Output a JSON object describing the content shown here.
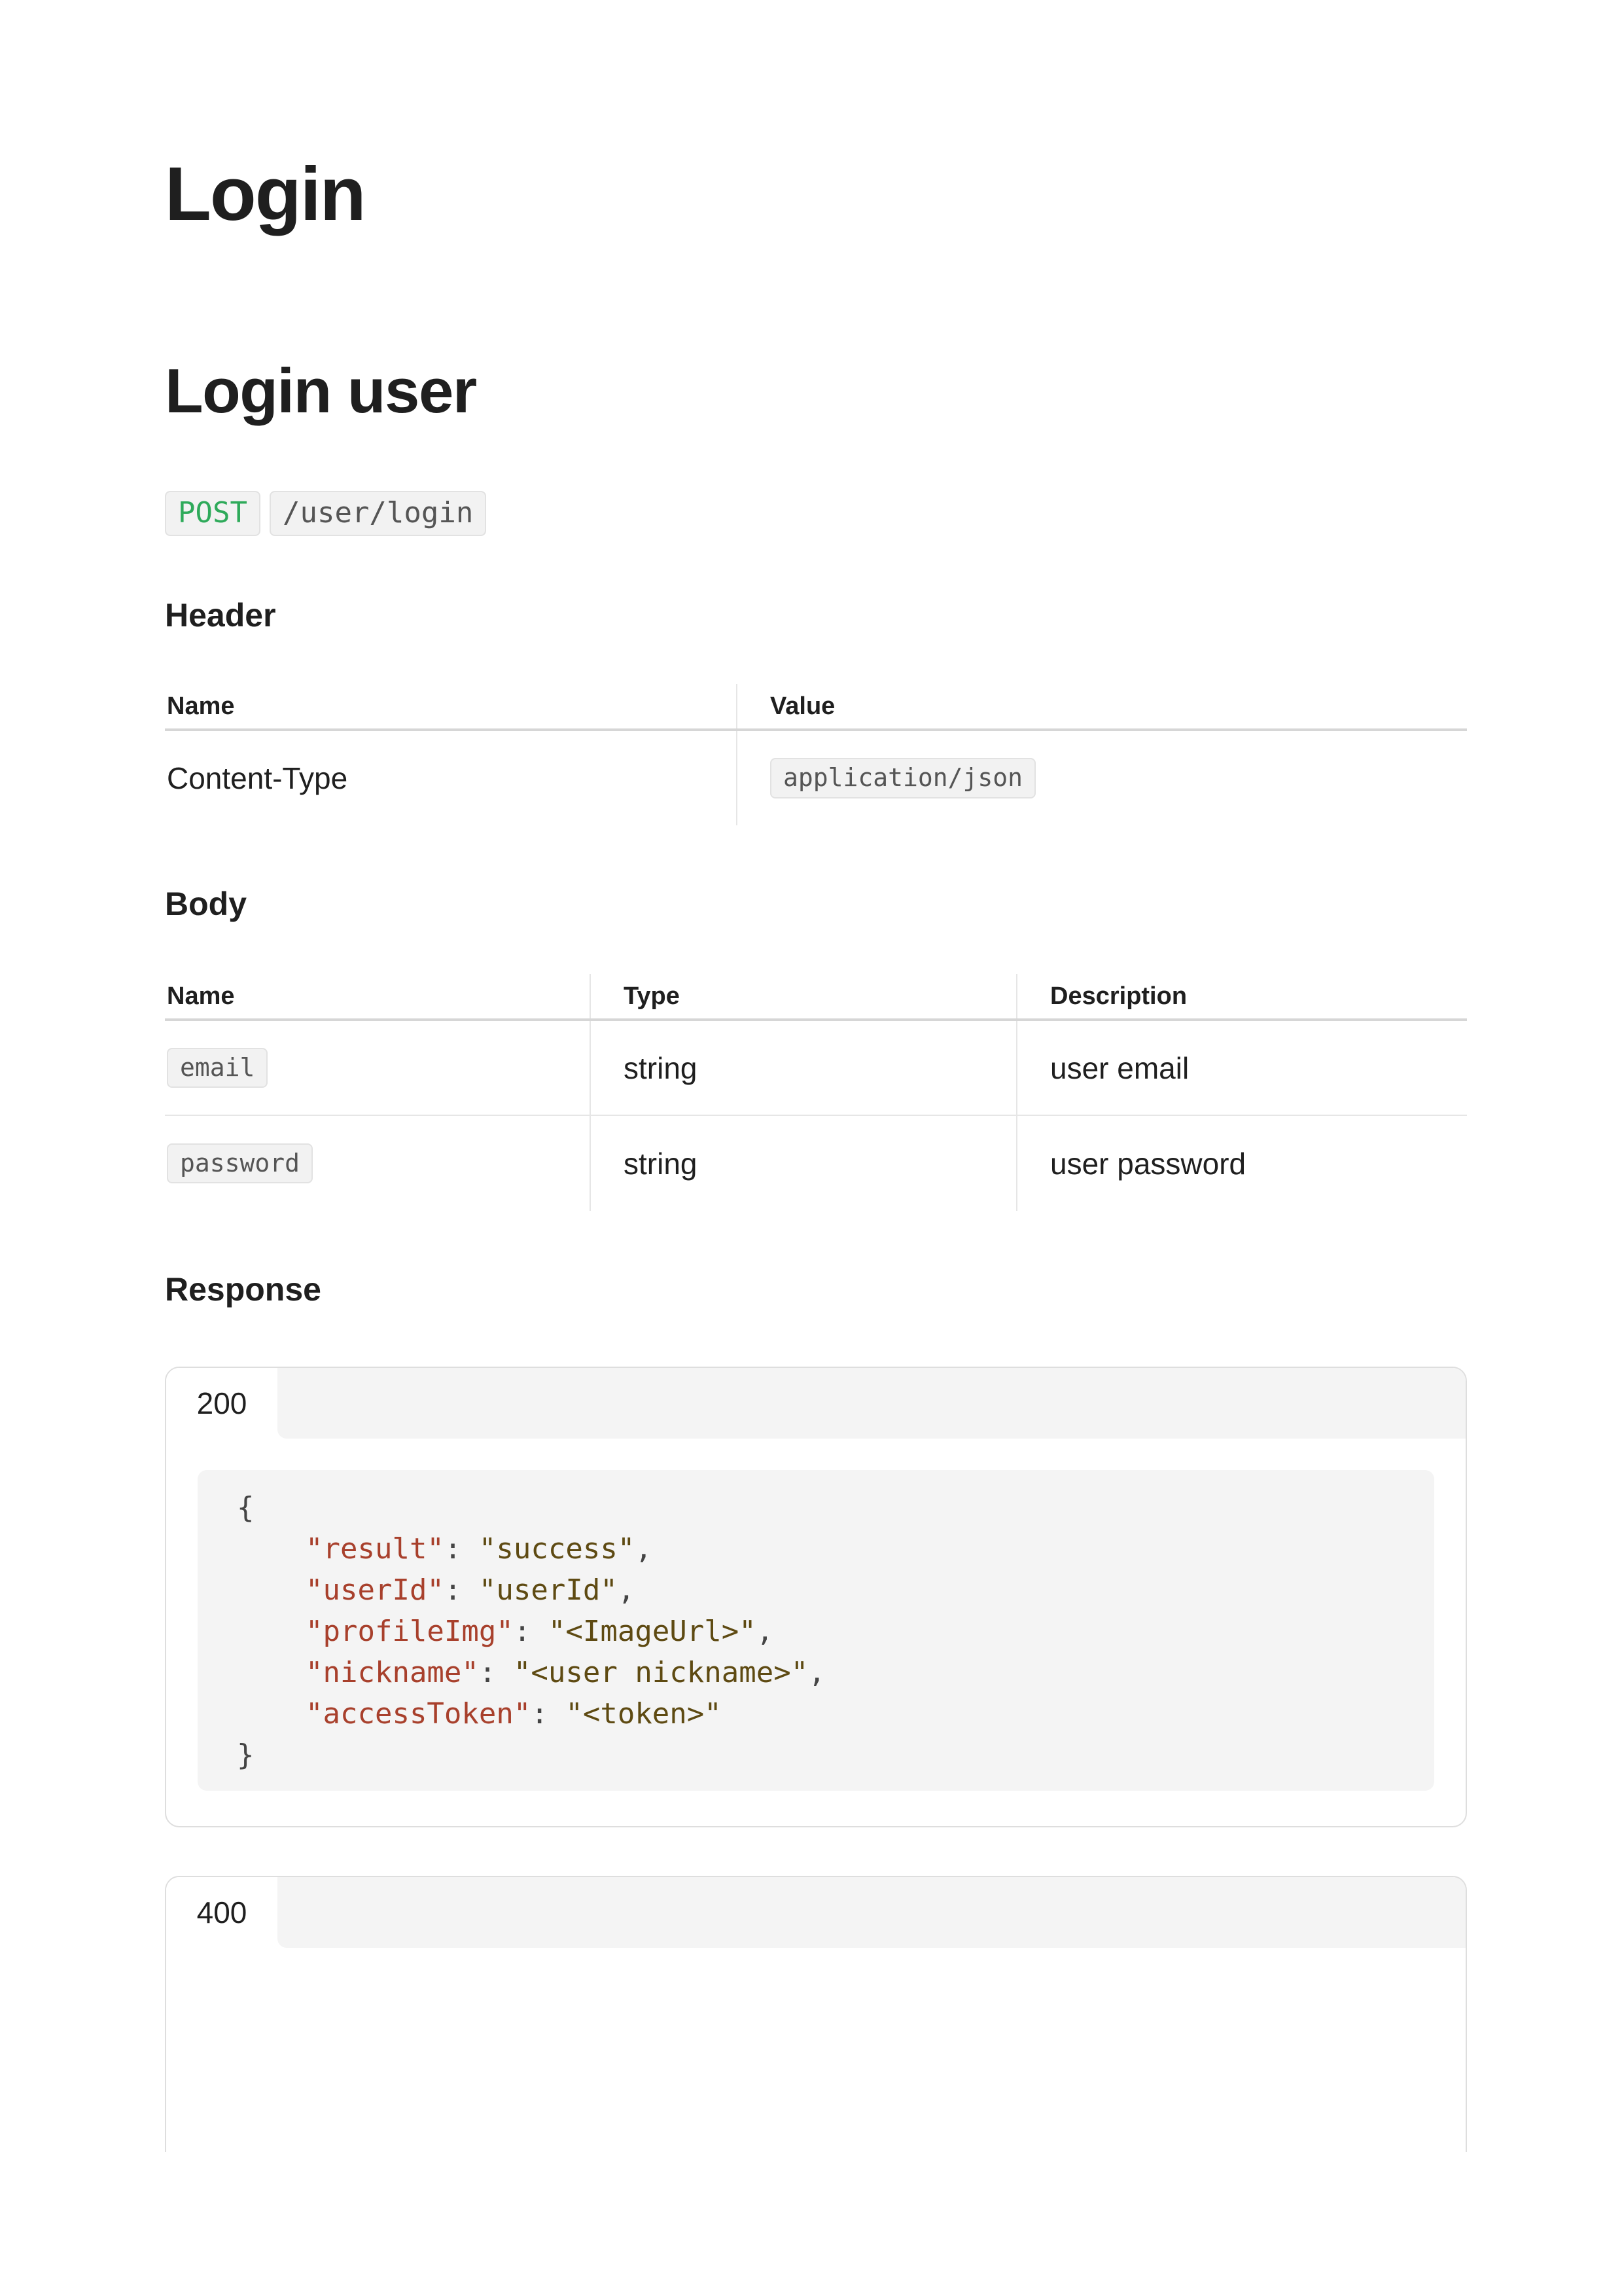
{
  "doc_title": "Login",
  "section_title": "Login user",
  "endpoint": {
    "method": "POST",
    "path": "/user/login"
  },
  "header_section": {
    "title": "Header",
    "columns": [
      "Name",
      "Value"
    ],
    "rows": [
      {
        "name": "Content-Type",
        "value": "application/json"
      }
    ]
  },
  "body_section": {
    "title": "Body",
    "columns": [
      "Name",
      "Type",
      "Description"
    ],
    "rows": [
      {
        "name": "email",
        "type": "string",
        "description": "user email"
      },
      {
        "name": "password",
        "type": "string",
        "description": "user password"
      }
    ]
  },
  "response_section": {
    "title": "Response",
    "responses": [
      {
        "status": "200",
        "code": {
          "open": "{",
          "close": "}",
          "fields": [
            {
              "key": "\"result\"",
              "value": "\"success\"",
              "trail": ","
            },
            {
              "key": "\"userId\"",
              "value": "\"userId\"",
              "trail": ","
            },
            {
              "key": "\"profileImg\"",
              "value": "\"<ImageUrl>\"",
              "trail": ","
            },
            {
              "key": "\"nickname\"",
              "value": "\"<user nickname>\"",
              "trail": ","
            },
            {
              "key": "\"accessToken\"",
              "value": "\"<token>\"",
              "trail": ""
            }
          ]
        }
      },
      {
        "status": "400"
      }
    ]
  }
}
